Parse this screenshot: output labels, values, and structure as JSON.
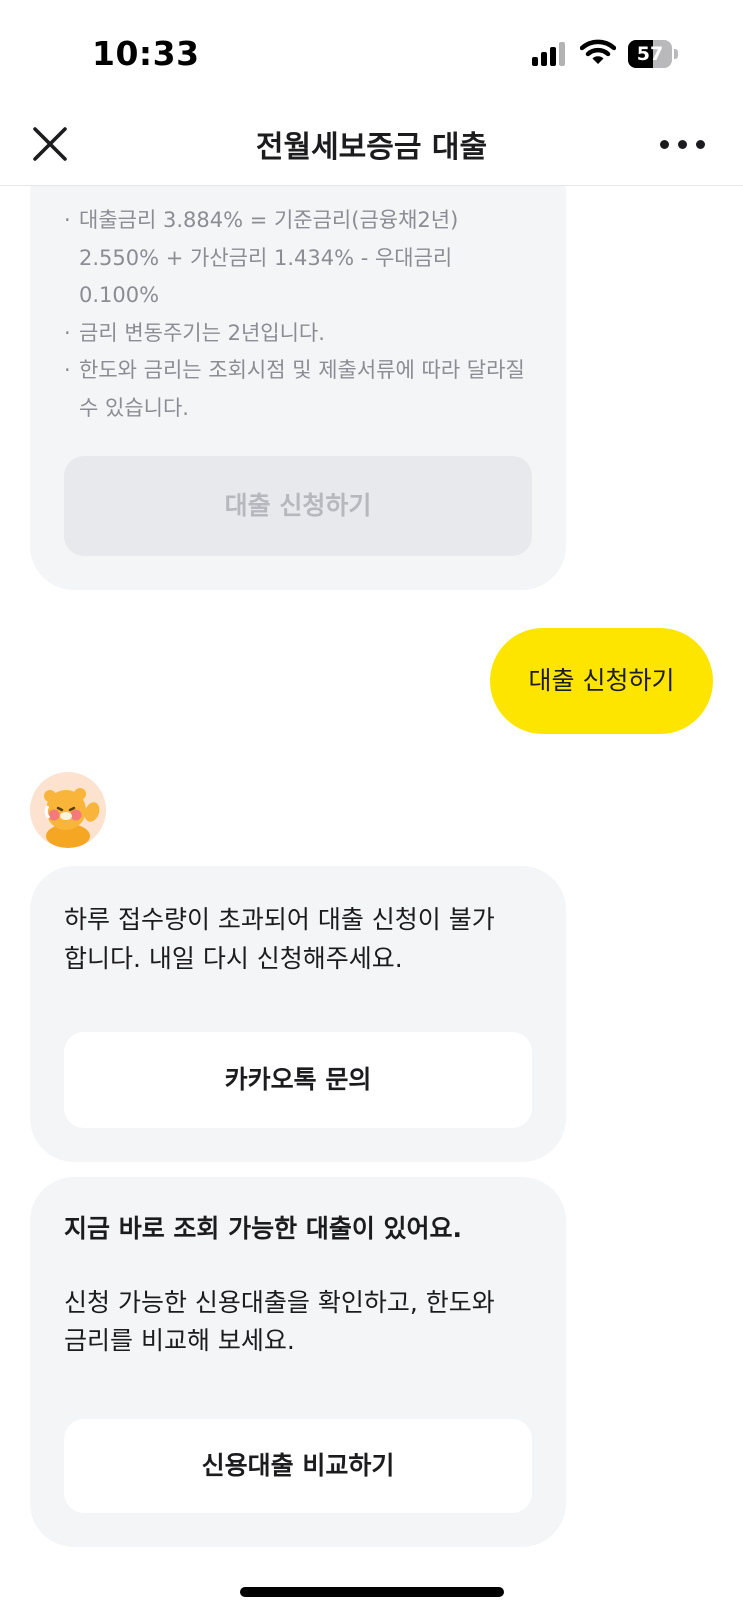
{
  "status_bar": {
    "time": "10:33",
    "battery_level": "57"
  },
  "header": {
    "title": "전월세보증금 대출"
  },
  "rate_card": {
    "notes": [
      [
        "대출금리 3.884% = 기준금리(금융채2년)",
        "2.550% + 가산금리 1.434% - 우대금리",
        "0.100%"
      ],
      [
        "금리 변동주기는 2년입니다."
      ],
      [
        "한도와 금리는 조회시점 및 제출서류에 따라 달라질",
        "수 있습니다."
      ]
    ],
    "apply_button": "대출 신청하기"
  },
  "user_message": "대출 신청하기",
  "bot_reply": {
    "lines": [
      "하루 접수량이 초과되어 대출 신청이 불가",
      "합니다. 내일 다시 신청해주세요."
    ],
    "button": "카카오톡 문의"
  },
  "suggestion_card": {
    "title": "지금 바로 조회 가능한 대출이 있어요.",
    "lines": [
      "신청 가능한 신용대출을 확인하고, 한도와",
      "금리를 비교해 보세요."
    ],
    "button": "신용대출 비교하기"
  },
  "colors": {
    "accent_yellow": "#fee500",
    "card_bg": "#f4f5f7",
    "muted_text": "#8a8d93"
  }
}
